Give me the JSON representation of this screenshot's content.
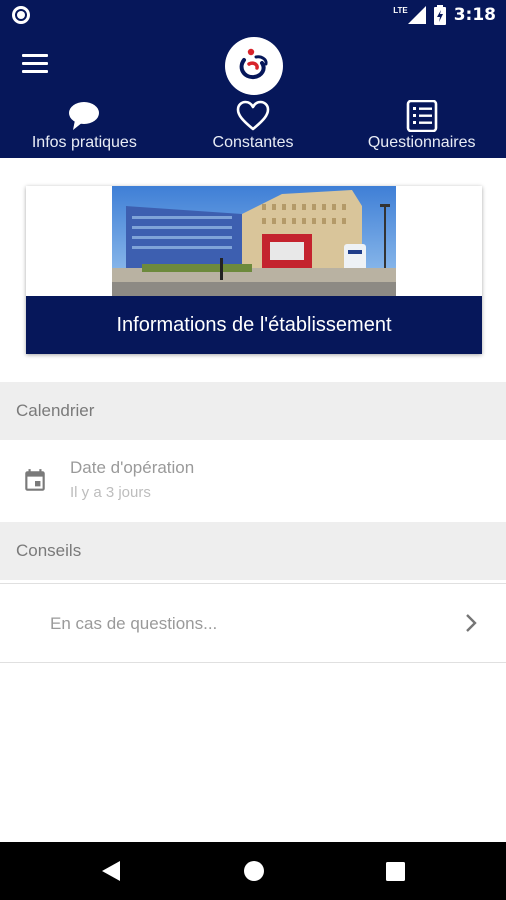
{
  "status_bar": {
    "network": "LTE",
    "time": "3:18"
  },
  "app_bar": {
    "menu_icon": "hamburger-menu-icon",
    "logo_icon": "hospital-logo-icon",
    "tabs": [
      {
        "label": "Infos pratiques",
        "icon": "chat-bubble-icon",
        "selected": true
      },
      {
        "label": "Constantes",
        "icon": "heart-icon",
        "selected": false
      },
      {
        "label": "Questionnaires",
        "icon": "checklist-icon",
        "selected": false
      }
    ]
  },
  "establishment_card": {
    "title": "Informations de l'établissement"
  },
  "calendar": {
    "header": "Calendrier",
    "item": {
      "icon": "calendar-icon",
      "title": "Date d'opération",
      "subtitle": "Il y a 3 jours"
    }
  },
  "advice": {
    "header": "Conseils",
    "item": {
      "label": "En cas de questions...",
      "icon": "chevron-right-icon"
    }
  },
  "colors": {
    "primary": "#06175a",
    "section_bg": "#eeeeee",
    "text_muted": "#9a9a9a"
  },
  "nav_bar": {
    "back_icon": "back-triangle-icon",
    "home_icon": "home-circle-icon",
    "recents_icon": "recents-square-icon"
  }
}
